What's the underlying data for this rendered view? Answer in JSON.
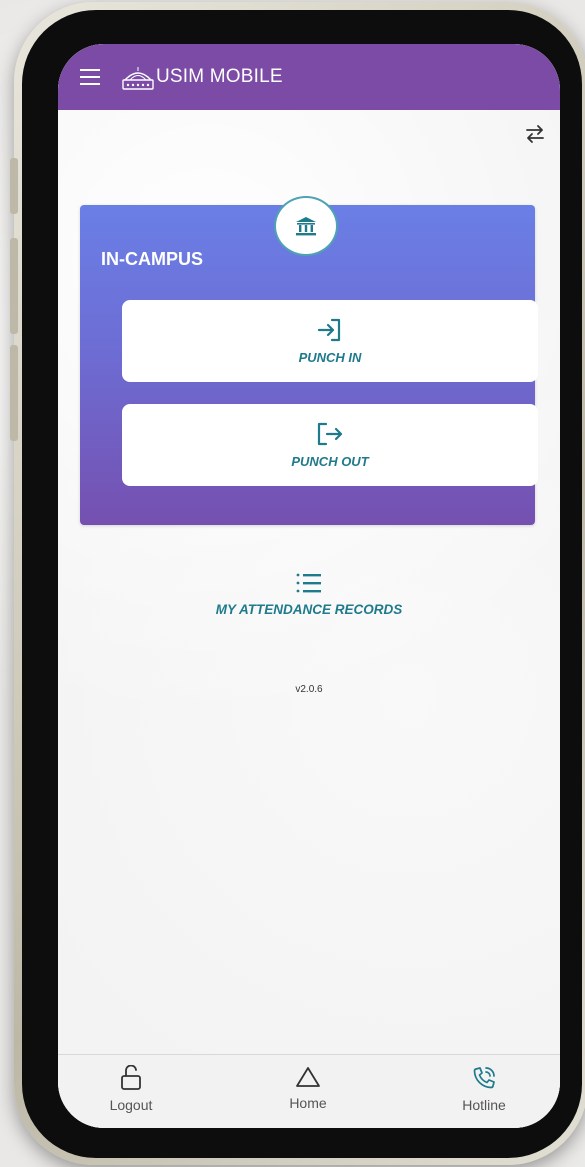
{
  "app": {
    "title": "USIM MOBILE"
  },
  "card": {
    "title": "IN-CAMPUS",
    "punch_in": "PUNCH IN",
    "punch_out": "PUNCH OUT"
  },
  "records": {
    "label": "MY ATTENDANCE RECORDS"
  },
  "version": "v2.0.6",
  "bottom_nav": {
    "logout": "Logout",
    "home": "Home",
    "hotline": "Hotline"
  },
  "colors": {
    "appbar": "#7b4ba6",
    "accent_text": "#1f7a8c",
    "card_top": "#6a7fe6",
    "card_bottom": "#7550b0"
  },
  "icons": [
    "menu-icon",
    "usim-logo-icon",
    "swap-icon",
    "bank-icon",
    "login-icon",
    "logout-arrow-icon",
    "list-icon",
    "lock-open-icon",
    "home-triangle-icon",
    "phone-call-icon"
  ]
}
